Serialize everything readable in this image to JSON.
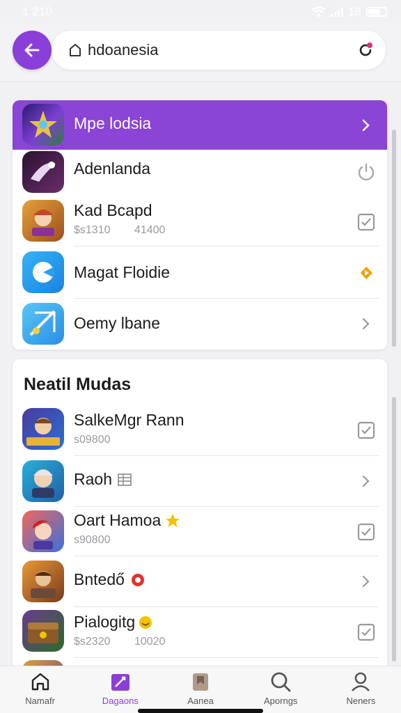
{
  "status_bar": {
    "time": "1:210",
    "battery_text": "18"
  },
  "top_bar": {
    "url": "hdoanesia"
  },
  "colors": {
    "accent": "#8a3fd8",
    "highlight": "#8a44d6",
    "star": "#f2c200",
    "badge_red": "#e03131",
    "orange_action": "#f0a000"
  },
  "list1": {
    "items": [
      {
        "title": "Mpe lodsia",
        "subtitle": "",
        "action": "chevron-right-icon"
      },
      {
        "title": "Adenlanda",
        "subtitle": "",
        "action": "power-icon"
      },
      {
        "title": "Kad Bcapd",
        "subtitle": "$s1310 41400",
        "action": "checkbox-icon"
      },
      {
        "title": "Magat Floidie",
        "subtitle": "",
        "action": "play-badge-icon"
      },
      {
        "title": "Oemy lbane",
        "subtitle": "",
        "action": "chevron-right-icon"
      }
    ]
  },
  "section": {
    "heading": "Neatil Mudas",
    "items": [
      {
        "title": "SalkeMgr Rann",
        "subtitle": "s09800",
        "action": "checkbox-icon"
      },
      {
        "title": "Raoh",
        "subtitle": "",
        "action": "chevron-right-icon"
      },
      {
        "title": "Oart Hamoa",
        "subtitle": "s90800",
        "action": "checkbox-icon"
      },
      {
        "title": "Bntedő",
        "subtitle": "",
        "action": "chevron-right-icon"
      },
      {
        "title": "Pialogitg",
        "subtitle": "$s2320 10020",
        "action": "checkbox-icon"
      }
    ]
  },
  "bottom_nav": {
    "items": [
      {
        "label": "Namafr",
        "icon": "home-icon",
        "active": false
      },
      {
        "label": "Dagaons",
        "icon": "edit-icon",
        "active": true
      },
      {
        "label": "Aanea",
        "icon": "book-icon",
        "active": false
      },
      {
        "label": "Aporngs",
        "icon": "search-icon",
        "active": false
      },
      {
        "label": "Neners",
        "icon": "person-icon",
        "active": false
      }
    ]
  }
}
